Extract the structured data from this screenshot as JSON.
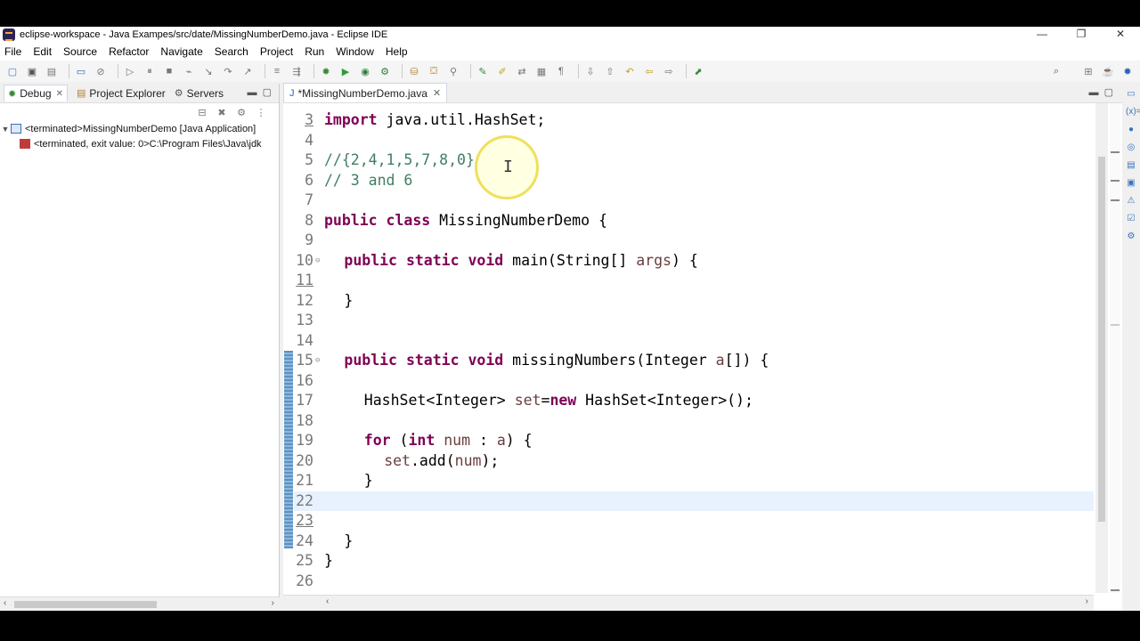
{
  "window": {
    "title": "eclipse-workspace - Java Exampes/src/date/MissingNumberDemo.java - Eclipse IDE",
    "controls": [
      "—",
      "❐",
      "✕"
    ]
  },
  "menu": [
    "File",
    "Edit",
    "Source",
    "Refactor",
    "Navigate",
    "Search",
    "Project",
    "Run",
    "Window",
    "Help"
  ],
  "left_panel": {
    "tabs": [
      {
        "label": "Debug",
        "icon": "debug-icon"
      },
      {
        "label": "Project Explorer",
        "icon": "project-explorer-icon"
      },
      {
        "label": "Servers",
        "icon": "servers-icon"
      }
    ],
    "tree": [
      {
        "label": "<terminated>MissingNumberDemo [Java Application]"
      },
      {
        "label": "<terminated, exit value: 0>C:\\Program Files\\Java\\jdk"
      }
    ]
  },
  "editor": {
    "tab_label": "*MissingNumberDemo.java",
    "lines": [
      {
        "num": "3",
        "text": "import java.util.HashSet;"
      },
      {
        "num": "4",
        "text": ""
      },
      {
        "num": "5",
        "text": "//{2,4,1,5,7,8,0}"
      },
      {
        "num": "6",
        "text": "// 3 and 6"
      },
      {
        "num": "7",
        "text": ""
      },
      {
        "num": "8",
        "text": "public class MissingNumberDemo {"
      },
      {
        "num": "9",
        "text": ""
      },
      {
        "num": "10",
        "text": "public static void main(String[] args) {"
      },
      {
        "num": "11",
        "text": ""
      },
      {
        "num": "12",
        "text": "}"
      },
      {
        "num": "13",
        "text": ""
      },
      {
        "num": "14",
        "text": ""
      },
      {
        "num": "15",
        "text": "public static void missingNumbers(Integer a[]) {"
      },
      {
        "num": "16",
        "text": ""
      },
      {
        "num": "17",
        "text": "HashSet<Integer> set=new HashSet<Integer>();"
      },
      {
        "num": "18",
        "text": ""
      },
      {
        "num": "19",
        "text": "for (int num : a) {"
      },
      {
        "num": "20",
        "text": "set.add(num);"
      },
      {
        "num": "21",
        "text": "}"
      },
      {
        "num": "22",
        "text": ""
      },
      {
        "num": "23",
        "text": ""
      },
      {
        "num": "24",
        "text": "}"
      },
      {
        "num": "25",
        "text": "}"
      },
      {
        "num": "26",
        "text": ""
      }
    ]
  }
}
